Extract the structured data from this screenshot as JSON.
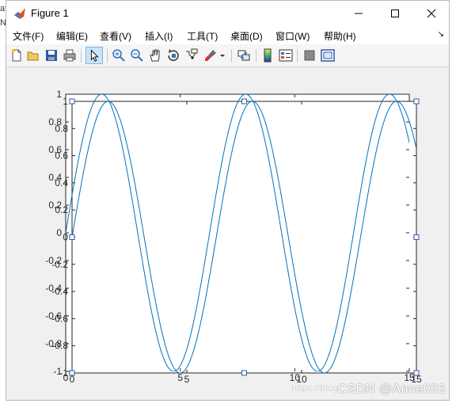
{
  "window": {
    "title": "Figure 1"
  },
  "background_fragments": [
    "at",
    "N"
  ],
  "menu": [
    {
      "label": "文件(F)"
    },
    {
      "label": "编辑(E)"
    },
    {
      "label": "查看(V)"
    },
    {
      "label": "插入(I)"
    },
    {
      "label": "工具(T)"
    },
    {
      "label": "桌面(D)"
    },
    {
      "label": "窗口(W)"
    },
    {
      "label": "帮助(H)"
    }
  ],
  "toolbar": [
    {
      "icon": "new-figure-icon"
    },
    {
      "icon": "open-file-icon"
    },
    {
      "icon": "save-icon"
    },
    {
      "icon": "print-icon"
    },
    {
      "icon": "edit-plot-arrow-icon",
      "selected": true
    },
    {
      "icon": "zoom-in-icon"
    },
    {
      "icon": "zoom-out-icon"
    },
    {
      "icon": "pan-hand-icon"
    },
    {
      "icon": "rotate-3d-icon"
    },
    {
      "icon": "data-cursor-icon"
    },
    {
      "icon": "brush-icon"
    },
    {
      "icon": "link-plot-icon"
    },
    {
      "icon": "colorbar-icon"
    },
    {
      "icon": "legend-icon"
    },
    {
      "icon": "hide-plot-tools-icon"
    },
    {
      "icon": "show-plot-tools-icon"
    }
  ],
  "watermark": {
    "url": "https://blog",
    "text": "CSDN @Anne033"
  },
  "colors": {
    "line": "#0072bd",
    "axes_bg": "#ffffff",
    "figure_bg": "#f0f0f0"
  },
  "chart_data": {
    "type": "line",
    "title": "",
    "xlabel": "",
    "ylabel": "",
    "xlim": [
      0,
      15
    ],
    "ylim": [
      -1,
      1
    ],
    "xticks_back": [
      "0",
      "5",
      "10",
      "15"
    ],
    "xticks_front": [
      "0",
      "5",
      "10",
      "15"
    ],
    "yticks_back": [
      "-1",
      "-0.8",
      "-0.6",
      "-0.4",
      "-0.2",
      "0",
      "0.2",
      "0.4",
      "0.6",
      "0.8",
      "1"
    ],
    "yticks_front": [
      "-1",
      "-0.8",
      "-0.6",
      "-0.4",
      "-0.2",
      "0",
      "0.2",
      "0.4",
      "0.6",
      "0.8",
      "1"
    ],
    "series": [
      {
        "function": "sin(x)",
        "x_range": [
          0,
          15
        ],
        "note_visible": "sine curve plotted twice on overlapping axes"
      }
    ],
    "grid": false,
    "legend": false
  }
}
